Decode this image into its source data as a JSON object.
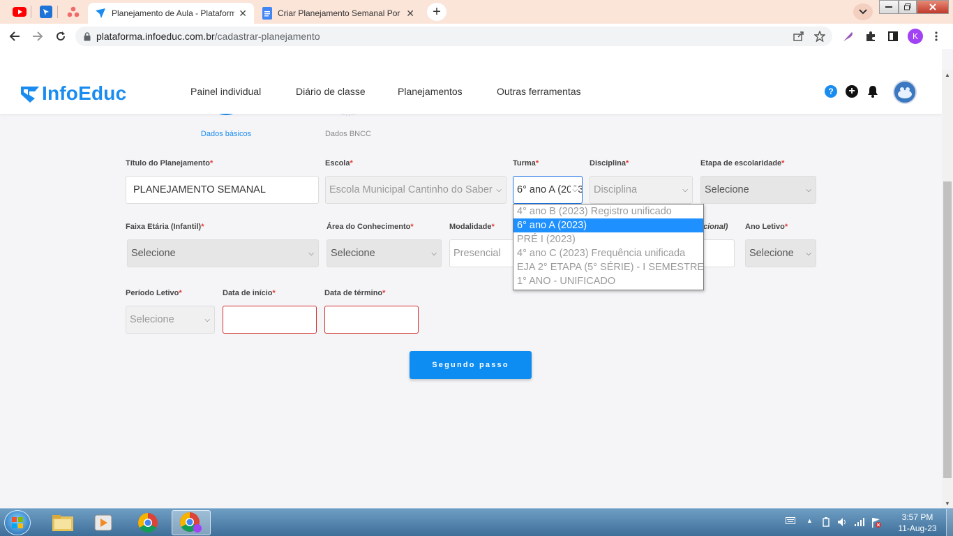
{
  "browser": {
    "tabs": [
      {
        "title": "Planejamento de Aula - Plataform",
        "close": "✕",
        "active": true
      },
      {
        "title": "Criar Planejamento Semanal Por Ha",
        "close": "✕",
        "active": false
      }
    ],
    "new_tab": "+",
    "url_host": "plataforma.infoeduc.com.br",
    "url_path": "/cadastrar-planejamento",
    "profile_initial": "K"
  },
  "header": {
    "logo_text": "InfoEduc",
    "menu": [
      "Painel individual",
      "Diário de classe",
      "Planejamentos",
      "Outras ferramentas"
    ],
    "help": "?",
    "add": "+"
  },
  "steps": [
    {
      "label": "Dados básicos",
      "active": true
    },
    {
      "label": "Dados BNCC",
      "active": false
    }
  ],
  "form": {
    "required_mark": "*",
    "titulo": {
      "label": "Título do Planejamento",
      "value": "PLANEJAMENTO SEMANAL"
    },
    "escola": {
      "label": "Escola",
      "value": "Escola Municipal Cantinho do Saber"
    },
    "turma": {
      "label": "Turma",
      "value": "6° ano A (2023)"
    },
    "disciplina": {
      "label": "Disciplina",
      "value": "Disciplina"
    },
    "etapa": {
      "label": "Etapa de escolaridade",
      "value": "Selecione"
    },
    "faixa": {
      "label": "Faixa Etária (Infantil)",
      "value": "Selecione"
    },
    "area": {
      "label": "Área do Conhecimento",
      "value": "Selecione"
    },
    "modalidade": {
      "label": "Modalidade",
      "value": "Presencial"
    },
    "opcional_fragment": "cional)",
    "ano_letivo": {
      "label": "Ano Letivo",
      "value": "Selecione"
    },
    "periodo": {
      "label": "Período Letivo",
      "value": "Selecione"
    },
    "data_inicio": {
      "label": "Data de início",
      "value": ""
    },
    "data_termino": {
      "label": "Data de término",
      "value": ""
    },
    "next_button": "Segundo passo"
  },
  "turma_dropdown": {
    "options": [
      "4° ano B (2023) Registro unificado",
      "6° ano A (2023)",
      "PRÉ I (2023)",
      "4° ano C (2023) Frequência unificada",
      "EJA 2° ETAPA (5° SÉRIE) - I SEMESTRE",
      "1° ANO - UNIFICADO"
    ],
    "selected_index": 1
  },
  "taskbar": {
    "time": "3:57 PM",
    "date": "11-Aug-23"
  }
}
